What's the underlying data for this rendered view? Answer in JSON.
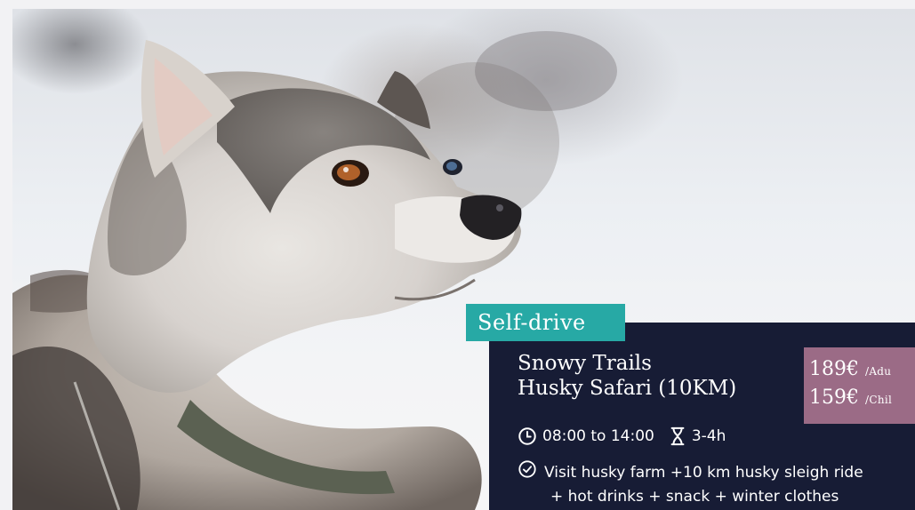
{
  "tour": {
    "badge": "Self-drive",
    "title_line1": "Snowy Trails",
    "title_line2": "Husky Safari (10KM)",
    "price_adult": "189€",
    "price_adult_unit": "/Adu",
    "price_child": "159€",
    "price_child_unit": "/Chil",
    "time_range": "08:00 to 14:00",
    "duration": "3-4h",
    "includes_line1": "Visit husky farm +10 km husky sleigh ride",
    "includes_line2": "+ hot drinks + snack + winter clothes"
  },
  "image": {
    "subject": "husky dog portrait in snow"
  },
  "colors": {
    "badge_bg": "#27a9a5",
    "panel_bg": "#171c35",
    "price_bg": "#9b6b86",
    "text": "#ffffff"
  },
  "icons": {
    "time": "clock-icon",
    "duration": "hourglass-icon",
    "includes": "check-circle-icon"
  }
}
